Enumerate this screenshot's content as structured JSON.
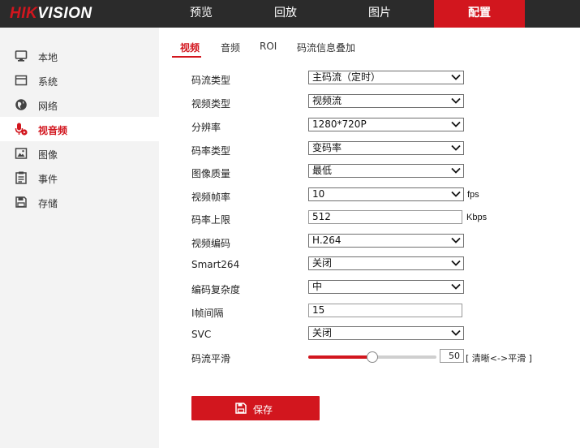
{
  "logo": {
    "brand_red": "HIK",
    "brand_white": "VISION"
  },
  "nav": {
    "items": [
      {
        "label": "预览"
      },
      {
        "label": "回放"
      },
      {
        "label": "图片"
      },
      {
        "label": "配置",
        "active": true
      }
    ]
  },
  "sidebar": {
    "items": [
      {
        "label": "本地",
        "icon": "monitor-icon"
      },
      {
        "label": "系统",
        "icon": "system-icon"
      },
      {
        "label": "网络",
        "icon": "globe-icon"
      },
      {
        "label": "视音频",
        "icon": "microphone-icon",
        "active": true
      },
      {
        "label": "图像",
        "icon": "image-icon"
      },
      {
        "label": "事件",
        "icon": "event-icon"
      },
      {
        "label": "存储",
        "icon": "save-disk-icon"
      }
    ]
  },
  "tabs": [
    {
      "label": "视频",
      "active": true
    },
    {
      "label": "音频"
    },
    {
      "label": "ROI"
    },
    {
      "label": "码流信息叠加"
    }
  ],
  "form": {
    "stream_type": {
      "label": "码流类型",
      "value": "主码流（定时）"
    },
    "video_type": {
      "label": "视频类型",
      "value": "视频流"
    },
    "resolution": {
      "label": "分辨率",
      "value": "1280*720P"
    },
    "bitrate_type": {
      "label": "码率类型",
      "value": "变码率"
    },
    "image_quality": {
      "label": "图像质量",
      "value": "最低"
    },
    "frame_rate": {
      "label": "视频帧率",
      "value": "10",
      "unit": "fps"
    },
    "max_bitrate": {
      "label": "码率上限",
      "value": "512",
      "unit": "Kbps"
    },
    "video_encoding": {
      "label": "视频编码",
      "value": "H.264"
    },
    "smart264": {
      "label": "Smart264",
      "value": "关闭"
    },
    "encoding_complexity": {
      "label": "编码复杂度",
      "value": "中"
    },
    "i_frame_interval": {
      "label": "I帧间隔",
      "value": "15"
    },
    "svc": {
      "label": "SVC",
      "value": "关闭"
    },
    "stream_smoothing": {
      "label": "码流平滑",
      "value": 50,
      "value_text": "50",
      "max": 100,
      "hint": "[ 清晰<->平滑 ]"
    }
  },
  "save_button": {
    "label": "保存"
  },
  "colors": {
    "accent": "#d2161e",
    "topbar": "#2b2b2b",
    "sidebar": "#f3f3f3"
  }
}
